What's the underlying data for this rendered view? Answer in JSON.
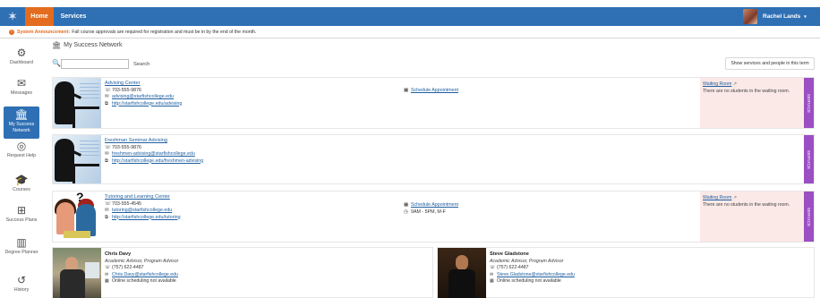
{
  "topbar": {
    "tabs": [
      {
        "label": "Home",
        "active": true
      },
      {
        "label": "Services",
        "active": false
      }
    ],
    "user": {
      "name": "Rachel Lands",
      "caret": "▾"
    },
    "accent": "#2f6fb3",
    "active_tab_color": "#e36c1f"
  },
  "announcement": {
    "label": "System Announcement:",
    "text": "Fall course approvals are required for registration and must be in by the end of the month."
  },
  "nav": {
    "items": [
      {
        "label": "Dashboard",
        "icon": "dashboard-icon"
      },
      {
        "label": "Messages",
        "icon": "envelope-icon"
      },
      {
        "label": "My Success Network",
        "icon": "institution-icon",
        "active": true
      },
      {
        "label": "Request Help",
        "icon": "lifebuoy-icon"
      },
      {
        "label": "Courses",
        "icon": "graduation-cap-icon"
      },
      {
        "label": "Success Plans",
        "icon": "sitemap-icon"
      },
      {
        "label": "Degree Planner",
        "icon": "map-icon"
      },
      {
        "label": "History",
        "icon": "history-icon"
      }
    ]
  },
  "page": {
    "title": "My Success Network",
    "search_button": "Search",
    "search_value": "",
    "show_button": "Show services and people in this term"
  },
  "services": [
    {
      "title": "Advising Center",
      "phone": "703-555-9876",
      "email": "advising@starfishcollege.edu",
      "url": "http://starfishcollege.edu/advising",
      "schedule": "Schedule Appointment",
      "hours": "",
      "waiting_room": "Waiting Room",
      "waiting_text": "There are no students in the waiting room.",
      "badge": "SERVICE"
    },
    {
      "title": "Freshman Seminar Advising",
      "phone": "703-555-9876",
      "email": "freshmen-advising@starfishcollege.edu",
      "url": "http://starfishcollege.edu/freshmen-advising",
      "schedule": "",
      "hours": "",
      "waiting_room": "",
      "waiting_text": "",
      "badge": "SERVICE"
    },
    {
      "title": "Tutoring and Learning Center",
      "phone": "703-555-4545",
      "email": "tutoring@starfishcollege.edu",
      "url": "http://starfishcollege.edu/tutoring",
      "schedule": "Schedule Appointment",
      "hours": "9AM - 5PM, M-F",
      "waiting_room": "Waiting Room",
      "waiting_text": "There are no students in the waiting room.",
      "badge": "SERVICE"
    }
  ],
  "advisors": [
    {
      "name": "Chris Davy",
      "role": "Academic Advisor, Program Advisor",
      "phone": "(757) 622-4487",
      "email": "Chris.Davy@starfishcollege.edu",
      "scheduling": "Online scheduling not available"
    },
    {
      "name": "Steve Gladstone",
      "role": "Academic Advisor, Program Advisor",
      "phone": "(757) 622-4487",
      "email": "Steve.Gladstone@starfishcollege.edu",
      "scheduling": "Online scheduling not available"
    }
  ]
}
